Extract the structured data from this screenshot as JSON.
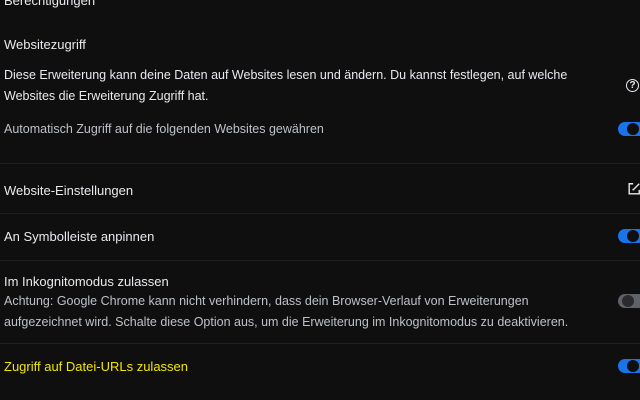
{
  "sections": {
    "permissions_heading": "Berechtigungen",
    "site_access": {
      "title": "Websitezugriff",
      "description_line1": "Diese Erweiterung kann deine Daten auf Websites lesen und ändern. Du kannst festlegen, auf welche",
      "description_line2": "Websites die Erweiterung Zugriff hat.",
      "help_icon": "?",
      "auto_access_label": "Automatisch Zugriff auf die folgenden Websites gewähren",
      "auto_access_enabled": true
    },
    "site_settings": {
      "label": "Website-Einstellungen",
      "icon": "open-in-new-icon"
    },
    "pin_toolbar": {
      "label": "An Symbolleiste anpinnen",
      "enabled": true
    },
    "incognito": {
      "title": "Im Inkognitomodus zulassen",
      "warning_line1": "Achtung: Google Chrome kann nicht verhindern, dass dein Browser-Verlauf von Erweiterungen",
      "warning_line2": "aufgezeichnet wird. Schalte diese Option aus, um die Erweiterung im Inkognitomodus zu deaktivieren.",
      "enabled": false
    },
    "file_urls": {
      "label": "Zugriff auf Datei-URLs zulassen",
      "enabled": true,
      "label_color": "#f2e600"
    }
  },
  "colors": {
    "background": "#0f0f10",
    "accent": "#1a73e8",
    "text": "#e8eaed",
    "secondary_text": "#bdc1c6"
  }
}
